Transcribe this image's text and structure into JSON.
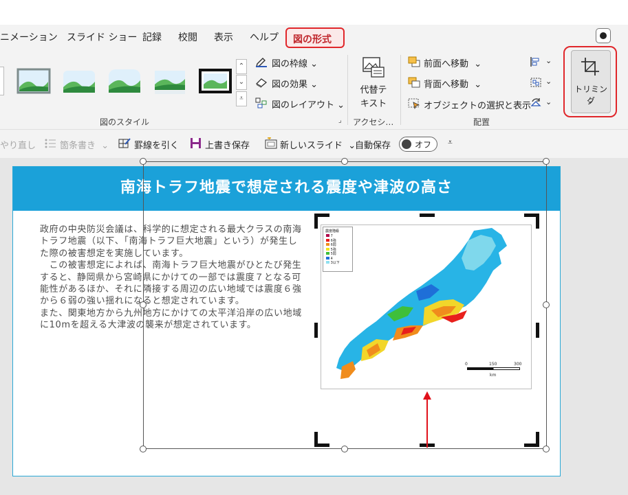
{
  "tabs": [
    "ニメーション",
    "スライド ショー",
    "記録",
    "校閲",
    "表示",
    "ヘルプ"
  ],
  "active_tab": "図の形式",
  "ribbon": {
    "picture_border": "図の枠線",
    "picture_effects": "図の効果",
    "picture_layout": "図のレイアウト",
    "styles_group": "図のスタイル",
    "alt_text_line1": "代替テ",
    "alt_text_line2": "キスト",
    "accessibility_group": "アクセシ…",
    "bring_forward": "前面へ移動",
    "send_backward": "背面へ移動",
    "selection_pane": "オブジェクトの選択と表示",
    "arrange_group": "配置",
    "crop": "トリミング"
  },
  "qat": {
    "redo": "やり直し",
    "bullets": "箇条書き",
    "draw_line": "罫線を引く",
    "save": "上書き保存",
    "new_slide": "新しいスライド",
    "autosave": "自動保存",
    "autosave_state": "オフ"
  },
  "slide": {
    "title": "南海トラフ地震で想定される震度や津波の高さ",
    "paragraphs": [
      "政府の中央防災会議は、科学的に想定される最大クラスの南海トラフ地震（以下、「南海トラフ巨大地震」という）が発生した際の被害想定を実施しています。",
      "　この被害想定によれば、南海トラフ巨大地震がひとたび発生すると、静岡県から宮崎県にかけての一部では震度７となる可能性があるほか、それに隣接する周辺の広い地域では震度６強から６弱の強い揺れになると想定されています。",
      "また、関東地方から九州地方にかけての太平洋沿岸の広い地域に10mを超える大津波の襲来が想定されています。"
    ],
    "map": {
      "legend_title": "震度階級",
      "legend_items": [
        "7",
        "6強",
        "6弱",
        "5強",
        "5弱",
        "4",
        "3以下"
      ],
      "legend_colors": [
        "#b0004a",
        "#e8201c",
        "#f08c1c",
        "#f3e31c",
        "#3fbf3a",
        "#1e6fd8",
        "#8fe0f0"
      ],
      "scale_ticks": [
        "0",
        "150",
        "300"
      ],
      "scale_unit": "km"
    }
  },
  "colors": {
    "accent_red": "#e0262a",
    "title_bar": "#1ba1d9",
    "arrow": "#e0101a"
  }
}
